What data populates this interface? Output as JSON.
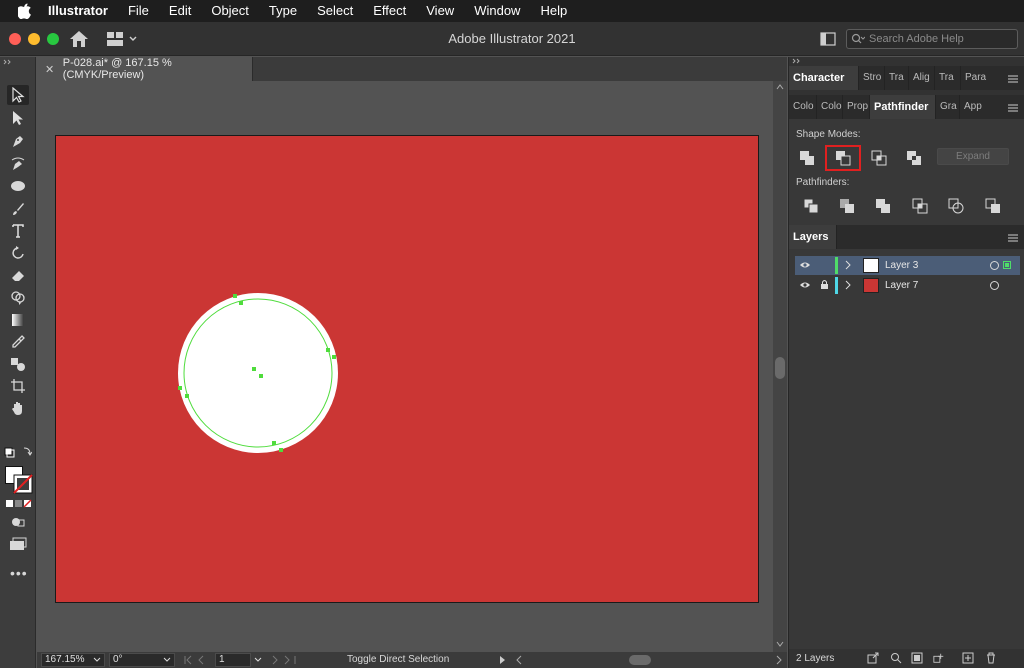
{
  "menubar": {
    "app_name": "Illustrator",
    "items": [
      "File",
      "Edit",
      "Object",
      "Type",
      "Select",
      "Effect",
      "View",
      "Window",
      "Help"
    ]
  },
  "window": {
    "title": "Adobe Illustrator 2021",
    "search_placeholder": "Search Adobe Help"
  },
  "document": {
    "tab_label": "P-028.ai* @ 167.15 % (CMYK/Preview)"
  },
  "tools": [
    "selection-tool",
    "direct-selection-tool",
    "pen-tool",
    "curvature-tool",
    "ellipse-tool",
    "paintbrush-tool",
    "type-tool",
    "rotate-tool",
    "eraser-tool",
    "shape-builder-tool",
    "gradient-tool",
    "eyedropper-tool",
    "blend-tool",
    "artboard-tool",
    "hand-tool"
  ],
  "panels": {
    "top_tabs": [
      "Character",
      "Stro",
      "Tra",
      "Alig",
      "Tra",
      "Para"
    ],
    "second_tabs": [
      "Colo",
      "Colo",
      "Prop",
      "Pathfinder",
      "Gra",
      "App"
    ],
    "pathfinder": {
      "shape_modes_label": "Shape Modes:",
      "pathfinders_label": "Pathfinders:",
      "expand_label": "Expand",
      "shape_modes": [
        "unite",
        "minus-front",
        "intersect",
        "exclude"
      ],
      "highlighted_mode": "minus-front",
      "pathfinder_ops": [
        "divide",
        "trim",
        "merge",
        "crop",
        "outline",
        "minus-back"
      ]
    },
    "layers": {
      "tab_label": "Layers",
      "rows": [
        {
          "name": "Layer 3",
          "color": "#4fdc69",
          "thumb_color": "#ffffff",
          "locked": false,
          "selected": true
        },
        {
          "name": "Layer 7",
          "color": "#4fd7e6",
          "thumb_color": "#cb3634",
          "locked": true,
          "selected": false
        }
      ],
      "count_label": "2 Layers"
    }
  },
  "statusbar": {
    "zoom": "167.15%",
    "rotation": "0°",
    "artboard_number": "1",
    "hint": "Toggle Direct Selection"
  },
  "colors": {
    "artboard_fill": "#cb3634",
    "circle_fill": "#ffffff",
    "selection_color": "#4fdc3c",
    "highlight_box": "#e02020"
  }
}
